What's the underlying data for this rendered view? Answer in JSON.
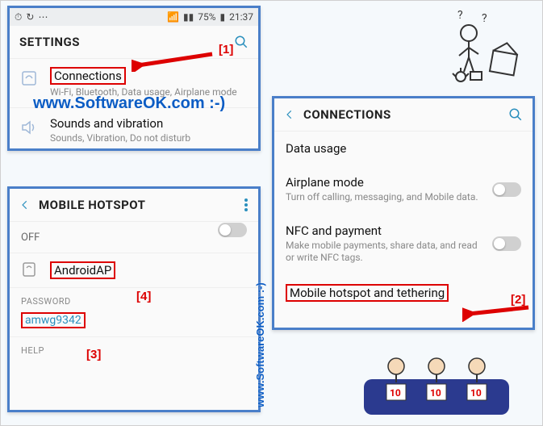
{
  "statusbar": {
    "battery_text": "75%",
    "time": "21:37"
  },
  "settings": {
    "header": "SETTINGS",
    "items": [
      {
        "title": "Connections",
        "sub": "Wi-Fi, Bluetooth, Data usage, Airplane mode"
      },
      {
        "title": "Sounds and vibration",
        "sub": "Sounds, Vibration, Do not disturb"
      }
    ]
  },
  "connections": {
    "header": "CONNECTIONS",
    "items": [
      {
        "title": "Data usage",
        "sub": ""
      },
      {
        "title": "Airplane mode",
        "sub": "Turn off calling, messaging, and Mobile data.",
        "toggle": "off"
      },
      {
        "title": "NFC and payment",
        "sub": "Make mobile payments, share data, and read or write NFC tags.",
        "toggle": "off"
      },
      {
        "title": "Mobile hotspot and tethering",
        "sub": ""
      }
    ]
  },
  "hotspot": {
    "header": "MOBILE HOTSPOT",
    "state": "OFF",
    "ssid": "AndroidAP",
    "password_label": "PASSWORD",
    "password": "amwg9342",
    "help_label": "HELP"
  },
  "annotations": {
    "a1": "[1]",
    "a2": "[2]",
    "a3": "[3]",
    "a4": "[4]"
  },
  "watermark": {
    "w1": "www.SoftwareOK.com :-)",
    "w2": "www.SoftwareOK.com :-)"
  }
}
